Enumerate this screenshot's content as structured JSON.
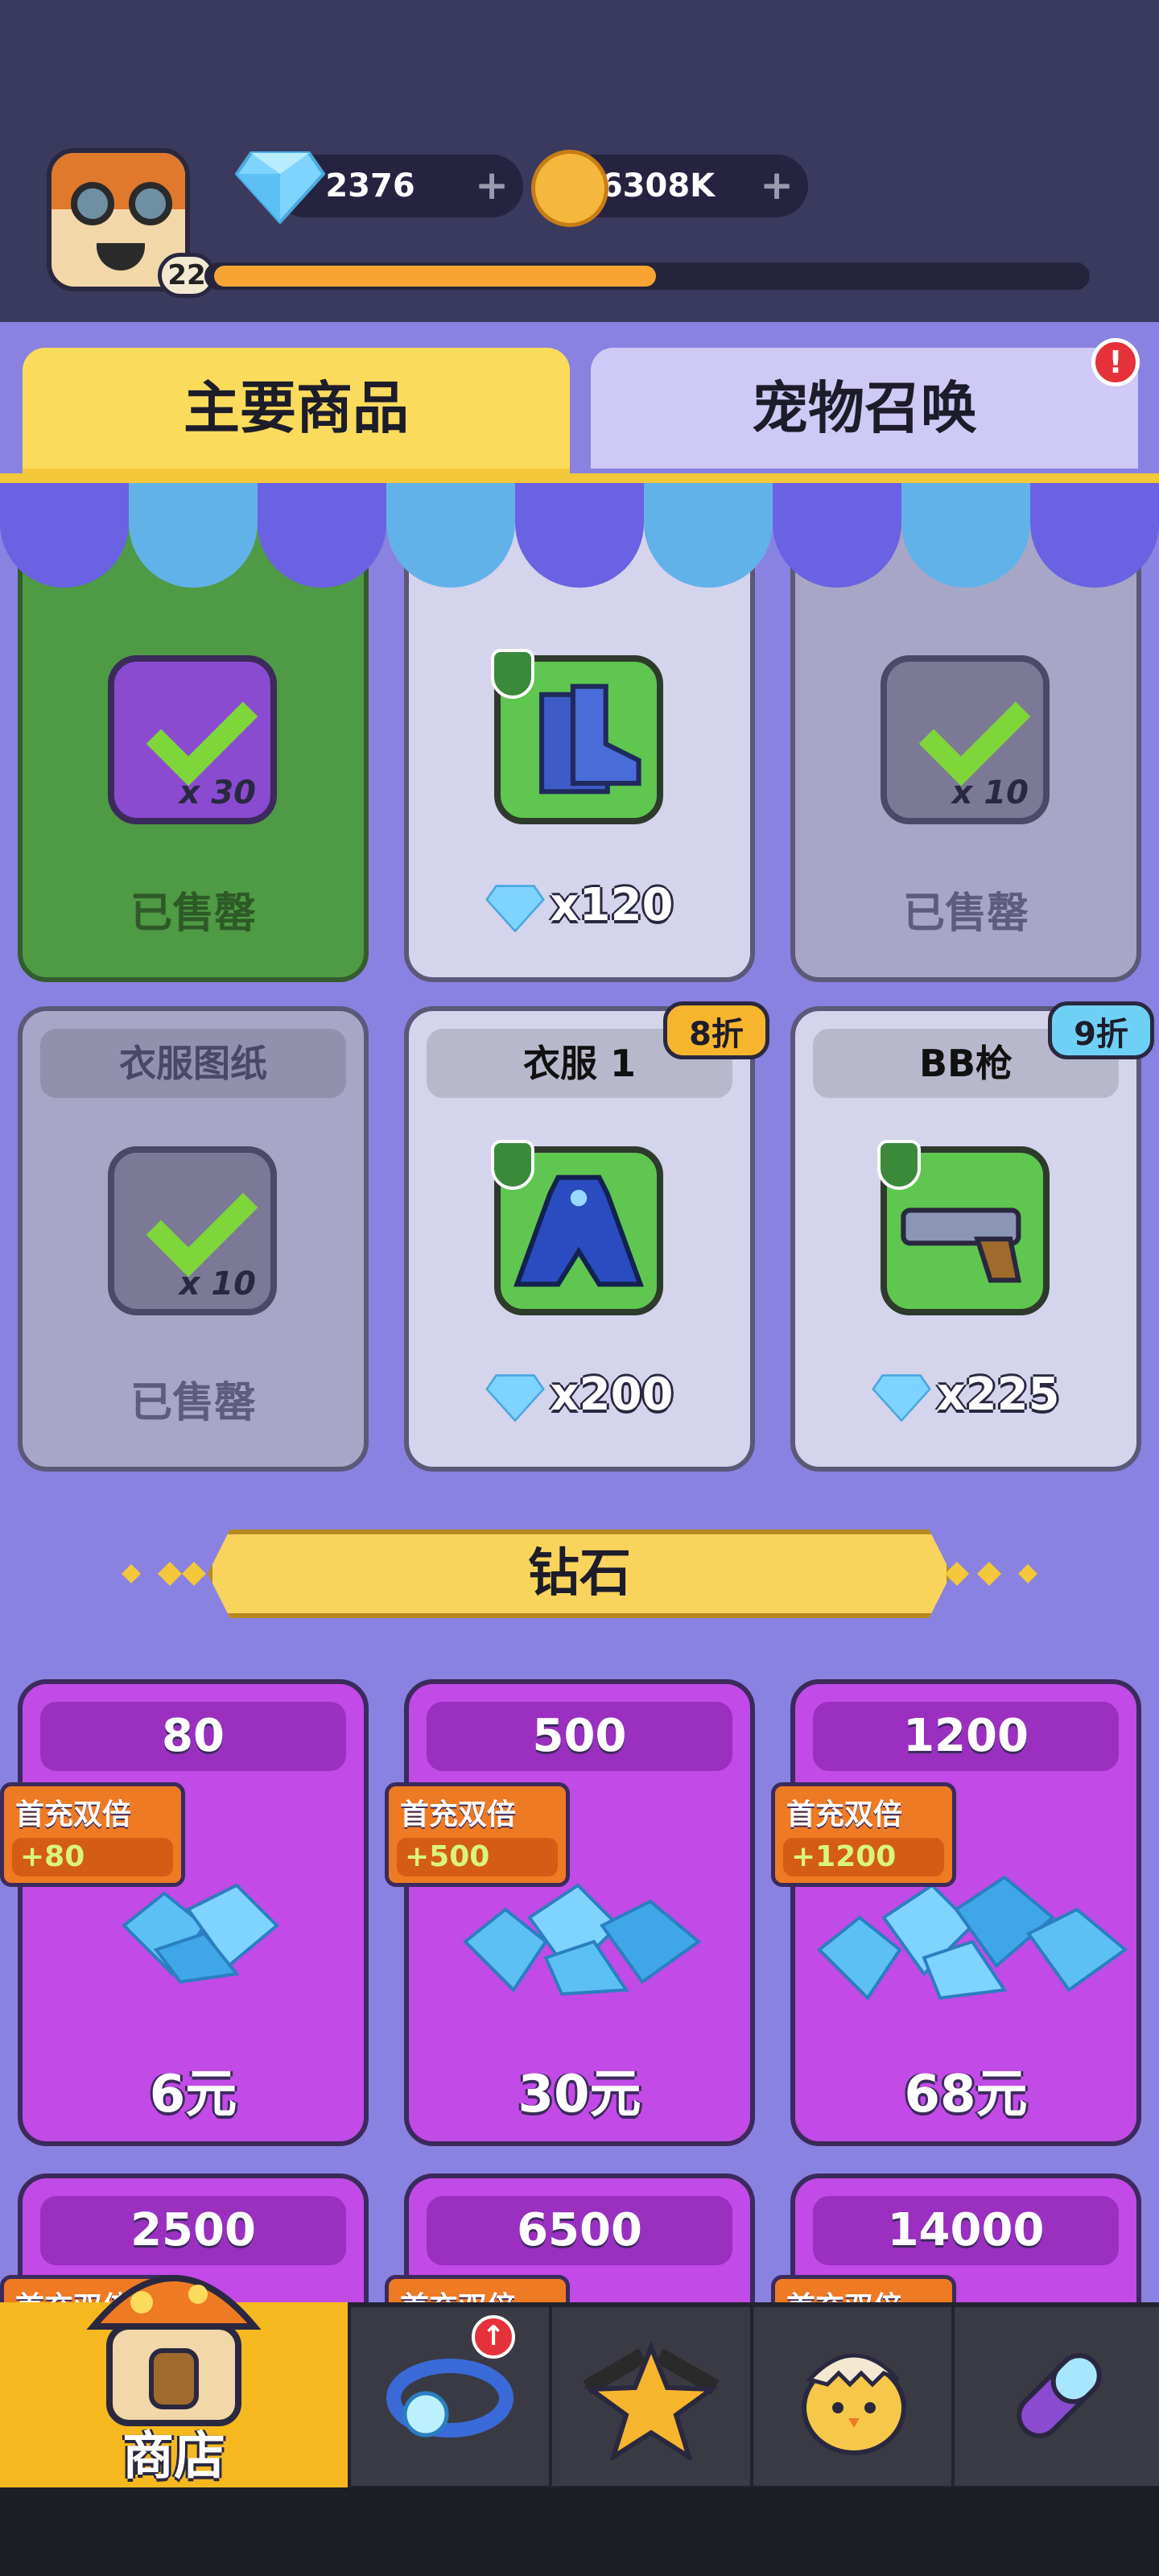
{
  "header": {
    "player_level": "22",
    "gems": "2376",
    "gold": "6308K",
    "xp_fraction": 0.51
  },
  "tabs": [
    {
      "label": "主要商品",
      "active": true
    },
    {
      "label": "宠物召唤",
      "active": false,
      "alert": "!"
    }
  ],
  "shop_items": [
    {
      "title": "",
      "qty": "x 30",
      "status": "已售罄"
    },
    {
      "title": "",
      "price": "x120"
    },
    {
      "title": "",
      "qty": "x 10",
      "status": "已售罄"
    },
    {
      "title": "衣服图纸",
      "qty": "x 10",
      "status": "已售罄"
    },
    {
      "title": "衣服 1",
      "price": "x200",
      "discount": "8折"
    },
    {
      "title": "BB枪",
      "price": "x225",
      "discount": "9折"
    }
  ],
  "diamond_section": {
    "title": "钻石"
  },
  "diamond_packs": [
    {
      "amount": "80",
      "price": "6元",
      "ribbon_title": "首充双倍",
      "bonus": "+80"
    },
    {
      "amount": "500",
      "price": "30元",
      "ribbon_title": "首充双倍",
      "bonus": "+500"
    },
    {
      "amount": "1200",
      "price": "68元",
      "ribbon_title": "首充双倍",
      "bonus": "+1200"
    },
    {
      "amount": "2500",
      "ribbon_title": "首充双倍"
    },
    {
      "amount": "6500",
      "ribbon_title": "首充双倍"
    },
    {
      "amount": "14000",
      "ribbon_title": "首充双倍"
    }
  ],
  "bottom_nav": {
    "shop_label": "商店",
    "icons": [
      "shop-icon",
      "ring-icon",
      "star-guns-icon",
      "chick-egg-icon",
      "capsule-icon"
    ]
  },
  "colors": {
    "accent_yellow": "#fbdb5c",
    "panel": "#8a82e0",
    "diamond_card": "#c24ae6",
    "gem": "#7fd3ff"
  }
}
